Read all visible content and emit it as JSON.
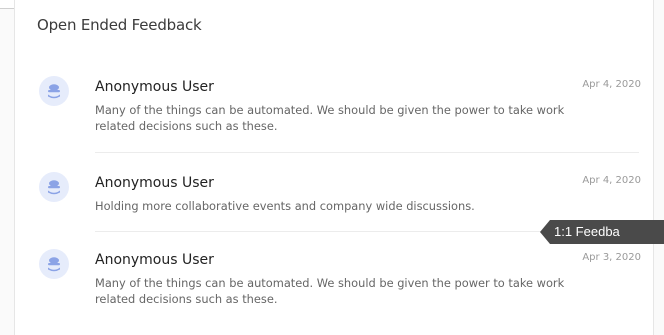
{
  "section": {
    "title": "Open Ended Feedback"
  },
  "feedback": [
    {
      "name": "Anonymous User",
      "date": "Apr 4, 2020",
      "text": "Many of the things can be automated. We should be given the power to take work related decisions such as these.",
      "avatar_icon": "user-avatar-icon"
    },
    {
      "name": "Anonymous User",
      "date": "Apr 4, 2020",
      "text": "Holding more collaborative events and company wide discussions.",
      "avatar_icon": "user-avatar-icon"
    },
    {
      "name": "Anonymous User",
      "date": "Apr 3, 2020",
      "text": "Many of the things can be automated. We should be given the power to take work related decisions such as these.",
      "avatar_icon": "user-avatar-icon"
    }
  ],
  "tag": {
    "label": "1:1 Feedba"
  },
  "colors": {
    "avatar_bg": "#e6ecfb",
    "avatar_fg": "#8ba3e6",
    "tag_bg": "#4a4a4a"
  }
}
